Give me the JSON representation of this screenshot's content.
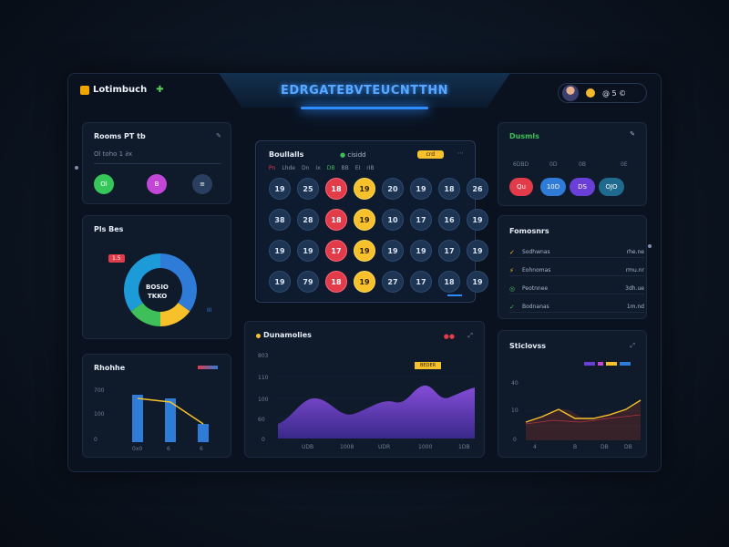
{
  "header": {
    "title": "EDRGATEBVTEUCNTTHN"
  },
  "brand": {
    "name": "Lotimbuch",
    "tool_icon": "wrench-icon"
  },
  "user": {
    "label": "@ 5 ©"
  },
  "panel_players": {
    "title": "Rooms PT tb",
    "subtitle": "Ol toho 1 ∂x",
    "buttons": [
      {
        "label": "Ol",
        "color": "#35c759"
      },
      {
        "label": "B",
        "color": "#c347d6"
      },
      {
        "label": "≡",
        "color": "#2a3f5f"
      }
    ]
  },
  "panel_donut": {
    "title": "Pls Bes",
    "badge": "1.5",
    "center_line1": "BOSIO",
    "center_line2": "TKKO",
    "legend": "III",
    "segments": [
      {
        "value": 35,
        "color": "#2f7bd8"
      },
      {
        "value": 15,
        "color": "#f6c12b"
      },
      {
        "value": 15,
        "color": "#3fbf5a"
      },
      {
        "value": 35,
        "color": "#1c9bd8"
      }
    ]
  },
  "panel_bars": {
    "title": "Rhohhe",
    "y_ticks": [
      "700",
      "100",
      "0"
    ],
    "x_ticks": [
      "0x0",
      "6",
      "6"
    ]
  },
  "keno": {
    "title": "Boullalls",
    "tag": "cisidd",
    "badge": "crd",
    "filters": [
      "Pn",
      "Lhde",
      "Dn",
      "Ix",
      "DB",
      "BB",
      "EI",
      "rIB"
    ],
    "numbers": [
      [
        {
          "n": "19",
          "s": ""
        },
        {
          "n": "25",
          "s": ""
        },
        {
          "n": "18",
          "s": "red"
        },
        {
          "n": "19",
          "s": "yellow"
        },
        {
          "n": "20",
          "s": ""
        },
        {
          "n": "19",
          "s": ""
        },
        {
          "n": "18",
          "s": ""
        },
        {
          "n": "26",
          "s": ""
        }
      ],
      [
        {
          "n": "38",
          "s": ""
        },
        {
          "n": "28",
          "s": ""
        },
        {
          "n": "18",
          "s": "red"
        },
        {
          "n": "19",
          "s": "yellow"
        },
        {
          "n": "10",
          "s": ""
        },
        {
          "n": "17",
          "s": ""
        },
        {
          "n": "16",
          "s": ""
        },
        {
          "n": "19",
          "s": ""
        }
      ],
      [
        {
          "n": "19",
          "s": ""
        },
        {
          "n": "19",
          "s": ""
        },
        {
          "n": "17",
          "s": "red"
        },
        {
          "n": "19",
          "s": "yellow"
        },
        {
          "n": "19",
          "s": ""
        },
        {
          "n": "19",
          "s": ""
        },
        {
          "n": "17",
          "s": ""
        },
        {
          "n": "19",
          "s": ""
        }
      ],
      [
        {
          "n": "19",
          "s": ""
        },
        {
          "n": "79",
          "s": ""
        },
        {
          "n": "18",
          "s": "red"
        },
        {
          "n": "19",
          "s": "yellow"
        },
        {
          "n": "27",
          "s": ""
        },
        {
          "n": "17",
          "s": ""
        },
        {
          "n": "18",
          "s": ""
        },
        {
          "n": "19",
          "s": ""
        }
      ]
    ]
  },
  "area_panel": {
    "title": "Dunamolies",
    "badge": "BEDER",
    "y_ticks": [
      "803",
      "110",
      "100",
      "60",
      "0"
    ],
    "x_ticks": [
      "UDB",
      "1008",
      "UDR",
      "1000",
      "1DB"
    ]
  },
  "panel_top_right": {
    "title": "Dusmls",
    "labels": [
      "6DBD",
      "0D",
      "0B",
      "0E"
    ],
    "pills": [
      {
        "label": "Qu",
        "color": "#e23b4a"
      },
      {
        "label": "10D",
        "color": "#2f7bd8"
      },
      {
        "label": "DS",
        "color": "#6a3fd8"
      },
      {
        "label": "OJO",
        "color": "#1f6b8f"
      }
    ]
  },
  "panel_list": {
    "title": "Fomosnrs",
    "rows": [
      {
        "label": "Sodhwnas",
        "value": "rhe.ne",
        "icon": "chevron-icon",
        "color": "#f6c12b"
      },
      {
        "label": "Eohnomas",
        "value": "rmu.nr",
        "icon": "bolt-icon",
        "color": "#f6c12b"
      },
      {
        "label": "Peotnnee",
        "value": "3dh.ue",
        "icon": "circle-icon",
        "color": "#3fbf5a"
      },
      {
        "label": "Bodnanas",
        "value": "1m.nd",
        "icon": "chevron-icon",
        "color": "#3fbf5a"
      }
    ]
  },
  "panel_line": {
    "title": "Sticlovss",
    "y_ticks": [
      "40",
      "10",
      "0"
    ],
    "x_ticks": [
      "4",
      "B",
      "DB",
      "DB"
    ]
  }
}
